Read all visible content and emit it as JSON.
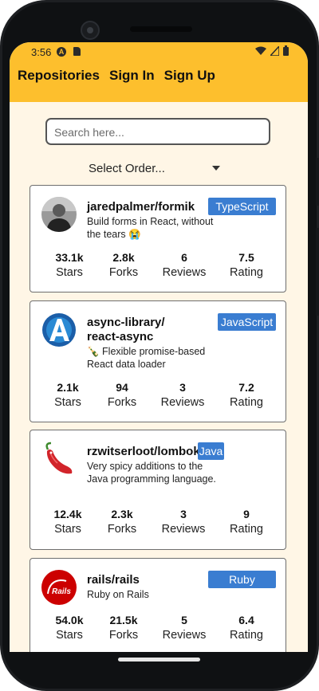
{
  "status": {
    "time": "3:56",
    "a_icon": "A"
  },
  "nav": {
    "repositories": "Repositories",
    "sign_in": "Sign In",
    "sign_up": "Sign Up"
  },
  "search": {
    "placeholder": "Search here...",
    "value": ""
  },
  "order": {
    "label": "Select Order..."
  },
  "colors": {
    "header": "#fdbf2d",
    "background": "#fff6e6",
    "language_badge": "#3a7dd1"
  },
  "repos": [
    {
      "full_name": "jaredpalmer/formik",
      "description": "Build forms in React, without the tears 😭",
      "language": "TypeScript",
      "avatar_icon": "person-photo-icon",
      "stats": [
        {
          "value": "33.1k",
          "label": "Stars"
        },
        {
          "value": "2.8k",
          "label": "Forks"
        },
        {
          "value": "6",
          "label": "Reviews"
        },
        {
          "value": "7.5",
          "label": "Rating"
        }
      ]
    },
    {
      "full_name_line1": "async-library/",
      "full_name_line2": "react-async",
      "description": "🍾 Flexible promise-based React data loader",
      "language": "JavaScript",
      "avatar_icon": "letter-a-logo-icon",
      "stats": [
        {
          "value": "2.1k",
          "label": "Stars"
        },
        {
          "value": "94",
          "label": "Forks"
        },
        {
          "value": "3",
          "label": "Reviews"
        },
        {
          "value": "7.2",
          "label": "Rating"
        }
      ]
    },
    {
      "full_name": "rzwitserloot/lombok",
      "description": "Very spicy additions to the Java programming language.",
      "language": "Java",
      "avatar_icon": "chili-pepper-icon",
      "stats": [
        {
          "value": "12.4k",
          "label": "Stars"
        },
        {
          "value": "2.3k",
          "label": "Forks"
        },
        {
          "value": "3",
          "label": "Reviews"
        },
        {
          "value": "9",
          "label": "Rating"
        }
      ]
    },
    {
      "full_name": "rails/rails",
      "description": "Ruby on Rails",
      "language": "Ruby",
      "avatar_icon": "rails-logo-icon",
      "stats": [
        {
          "value": "54.0k",
          "label": "Stars"
        },
        {
          "value": "21.5k",
          "label": "Forks"
        },
        {
          "value": "5",
          "label": "Reviews"
        },
        {
          "value": "6.4",
          "label": "Rating"
        }
      ]
    }
  ]
}
